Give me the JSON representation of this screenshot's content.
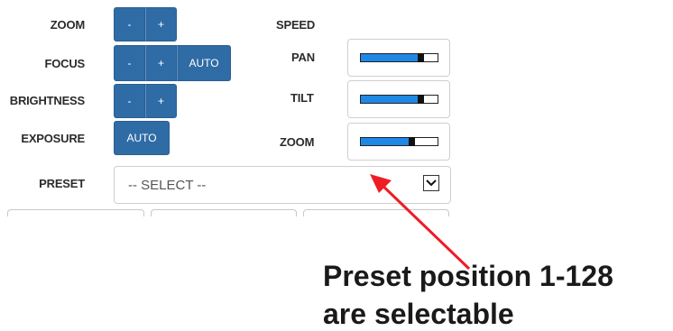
{
  "left_labels": {
    "zoom": "ZOOM",
    "focus": "FOCUS",
    "brightness": "BRIGHTNESS",
    "exposure": "EXPOSURE",
    "preset": "PRESET"
  },
  "buttons": {
    "minus": "-",
    "plus": "+",
    "auto": "AUTO"
  },
  "speed": {
    "header": "SPEED",
    "pan_label": "PAN",
    "tilt_label": "TILT",
    "zoom_label": "ZOOM",
    "pan_level": 0.78,
    "tilt_level": 0.78,
    "zoom_level": 0.66,
    "fill_color": "#1e88e5"
  },
  "preset": {
    "selected": "-- SELECT --",
    "arrow_icon": "chevron-down-icon"
  },
  "annotation": {
    "line1": "Preset position 1-128",
    "line2": "are selectable",
    "arrow_color": "#ee1c25"
  }
}
